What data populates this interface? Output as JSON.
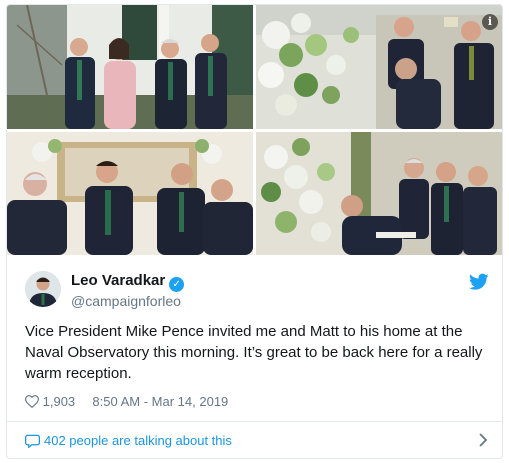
{
  "tweet": {
    "author_name": "Leo Varadkar",
    "handle": "@campaignforleo",
    "text": "Vice President Mike Pence invited me and Matt to his home at the Naval Observatory this morning. It’s great to be back here for a really warm reception.",
    "likes": "1,903",
    "timestamp": "8:50 AM - Mar 14, 2019",
    "talking": "402 people are talking about this"
  },
  "icons": {
    "info": "info-icon",
    "verified": "verified-badge-icon",
    "brand": "twitter-bird-icon",
    "heart": "heart-icon",
    "reply": "speech-bubble-icon",
    "chevron": "chevron-right-icon"
  },
  "colors": {
    "accent": "#1da1f2",
    "link": "#1b95e0",
    "text": "#14171a",
    "muted": "#657786",
    "border": "#e1e8ed"
  }
}
